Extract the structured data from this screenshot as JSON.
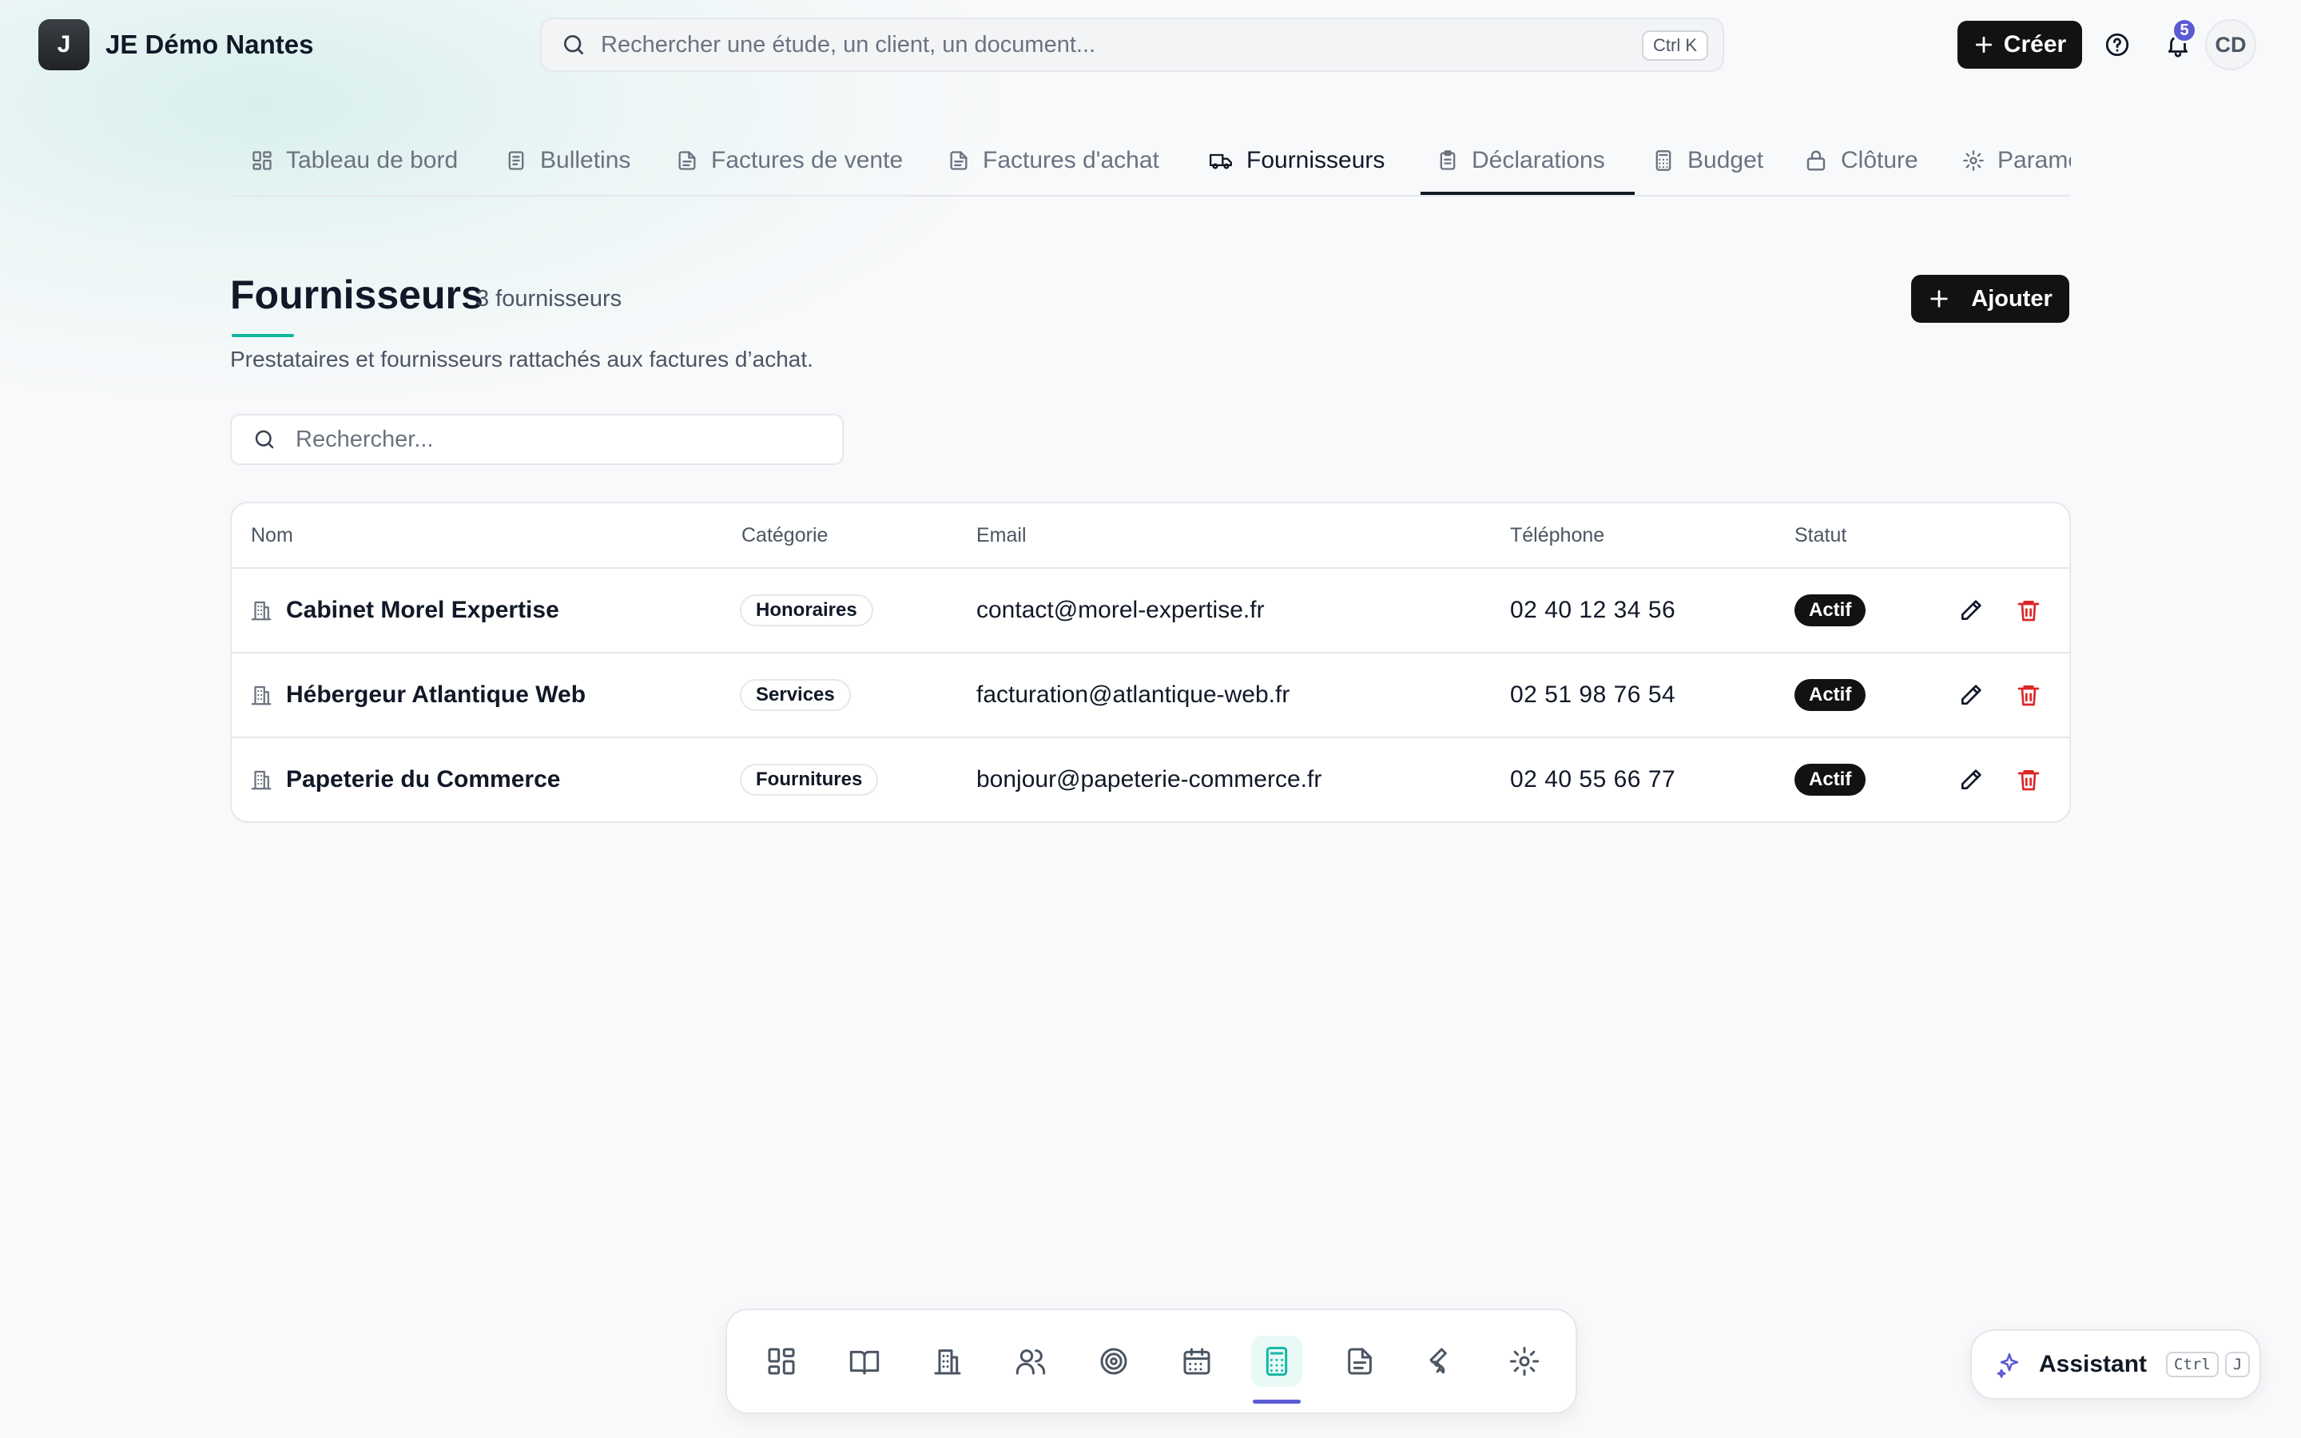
{
  "app": {
    "logo_letter": "J",
    "name": "JE Démo Nantes"
  },
  "search": {
    "placeholder": "Rechercher une étude, un client, un document...",
    "shortcut": "Ctrl K"
  },
  "header": {
    "create_label": "Créer",
    "notifications_count": "5",
    "avatar_initials": "CD"
  },
  "tabs": [
    {
      "label": "Tableau de bord",
      "icon": "dashboard-icon"
    },
    {
      "label": "Bulletins",
      "icon": "document-icon"
    },
    {
      "label": "Factures de vente",
      "icon": "file-icon"
    },
    {
      "label": "Factures d'achat",
      "icon": "file-icon"
    },
    {
      "label": "Fournisseurs",
      "icon": "truck-icon",
      "active": true
    },
    {
      "label": "Déclarations",
      "icon": "clipboard-icon"
    },
    {
      "label": "Budget",
      "icon": "calculator-icon"
    },
    {
      "label": "Clôture",
      "icon": "lock-icon"
    },
    {
      "label": "Paramètres",
      "icon": "gear-icon"
    }
  ],
  "page": {
    "title": "Fournisseurs",
    "count": "3 fournisseurs",
    "subtitle": "Prestataires et fournisseurs rattachés aux factures d’achat.",
    "add_label": "Ajouter",
    "search_placeholder": "Rechercher..."
  },
  "table": {
    "columns": [
      "Nom",
      "Catégorie",
      "Email",
      "Téléphone",
      "Statut"
    ],
    "rows": [
      {
        "name": "Cabinet Morel Expertise",
        "category": "Honoraires",
        "email": "contact@morel-expertise.fr",
        "phone": "02 40 12 34 56",
        "status": "Actif"
      },
      {
        "name": "Hébergeur Atlantique Web",
        "category": "Services",
        "email": "facturation@atlantique-web.fr",
        "phone": "02 51 98 76 54",
        "status": "Actif"
      },
      {
        "name": "Papeterie du Commerce",
        "category": "Fournitures",
        "email": "bonjour@papeterie-commerce.fr",
        "phone": "02 40 55 66 77",
        "status": "Actif"
      }
    ]
  },
  "dock": {
    "items": [
      "dashboard-icon",
      "book-icon",
      "building-icon",
      "users-icon",
      "target-icon",
      "calendar-icon",
      "calculator-icon",
      "file-icon",
      "wrench-icon",
      "gear-icon"
    ],
    "active_index": 6
  },
  "assistant": {
    "label": "Assistant",
    "key1": "Ctrl",
    "key2": "J"
  },
  "colors": {
    "accent": "#10b6a0",
    "primary_dark": "#111214",
    "danger": "#dc2626",
    "notification": "#5b5bd6"
  }
}
